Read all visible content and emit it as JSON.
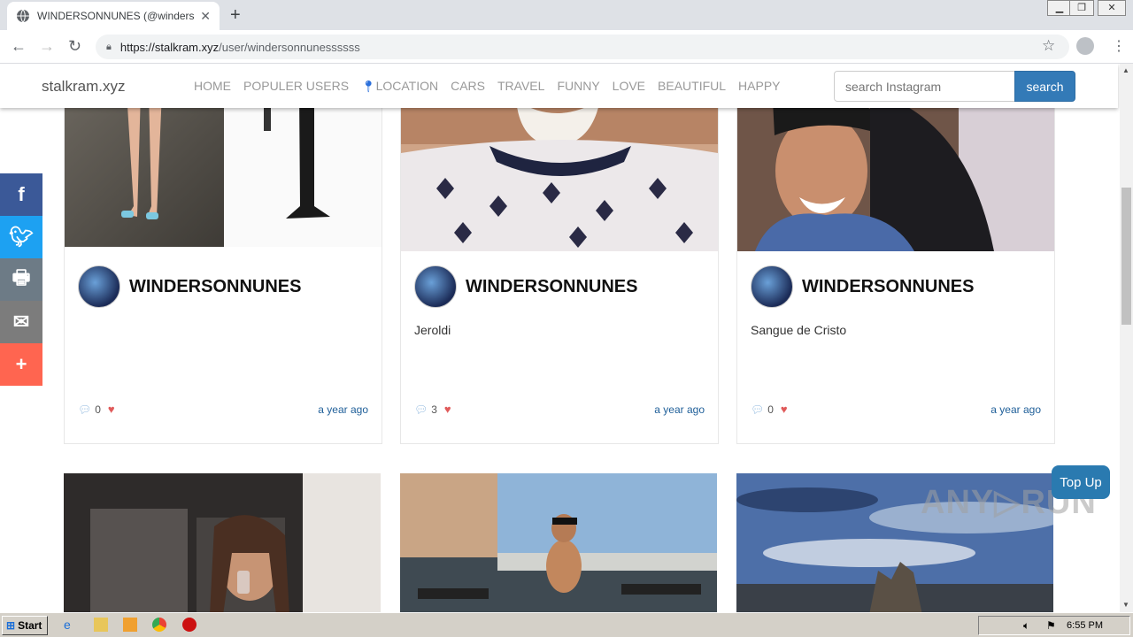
{
  "browser": {
    "tab_title": "WINDERSONNUNES (@windersonnu",
    "tab_close": "✕",
    "new_tab": "+",
    "url_domain": "https://stalkram.xyz",
    "url_path": "/user/windersonnunessssss"
  },
  "site": {
    "brand": "stalkram.xyz",
    "nav": [
      "HOME",
      "POPULER USERS",
      "LOCATION",
      "CARS",
      "TRAVEL",
      "FUNNY",
      "LOVE",
      "BEAUTIFUL",
      "HAPPY"
    ],
    "search_placeholder": "search Instagram",
    "search_button": "search"
  },
  "cards": [
    {
      "username": "WINDERSONNUNES",
      "caption": "",
      "comments": "0",
      "time": "a year ago"
    },
    {
      "username": "WINDERSONNUNES",
      "caption": "Jeroldi",
      "comments": "3",
      "time": "a year ago"
    },
    {
      "username": "WINDERSONNUNES",
      "caption": "Sangue de Cristo",
      "comments": "0",
      "time": "a year ago"
    }
  ],
  "share": [
    "f",
    "t",
    "print",
    "mail",
    "+"
  ],
  "top_up": "Top Up",
  "watermark": "ANY▷RUN",
  "taskbar": {
    "start": "Start",
    "clock": "6:55 PM"
  }
}
